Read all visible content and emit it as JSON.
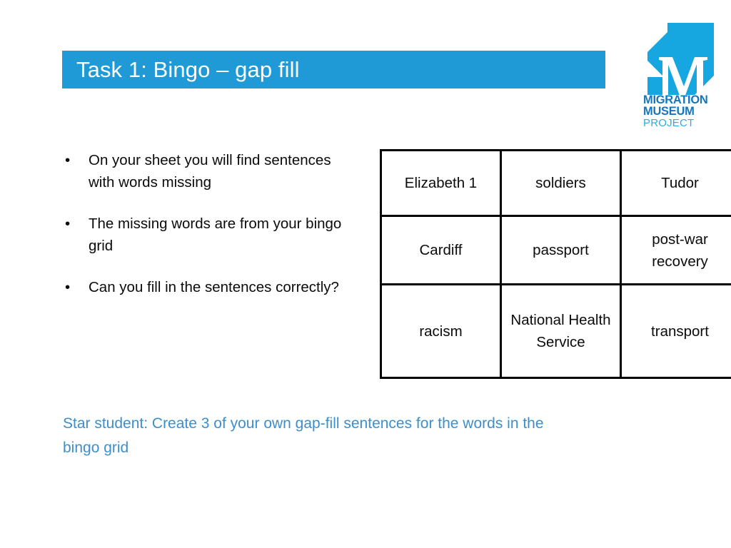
{
  "slide": {
    "title": "Task 1: Bingo – gap fill",
    "title_bar_color": "#1f9ad6"
  },
  "logo": {
    "line1": "MIGRATION",
    "line2": "MUSEUM",
    "line3": "PROJECT",
    "mark_letter": "M",
    "mark_color": "#17a7e0",
    "wordmark_color": "#1576bb",
    "project_color": "#2aade4"
  },
  "bullets": {
    "marker": "•",
    "items": [
      "On your sheet you will find sentences with words missing",
      "The missing words are from your bingo grid",
      "Can you fill in the sentences correctly?"
    ]
  },
  "bingo_grid": {
    "rows": [
      [
        "Elizabeth 1",
        "soldiers",
        "Tudor"
      ],
      [
        "Cardiff",
        "passport",
        "post-war recovery"
      ],
      [
        "racism",
        "National Health Service",
        "transport"
      ]
    ]
  },
  "star_note": {
    "text": "Star student: Create 3 of your own gap-fill sentences for the words in the bingo grid",
    "color": "#3d8ecb"
  }
}
